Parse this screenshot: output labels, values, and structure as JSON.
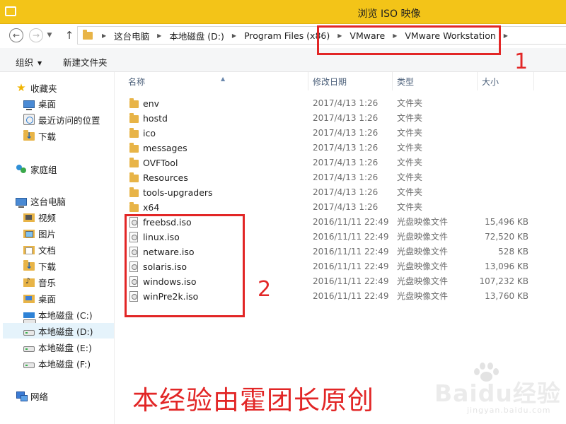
{
  "window": {
    "title": "浏览 ISO 映像",
    "accent_color": "#f3c418"
  },
  "address": {
    "crumbs": [
      "这台电脑",
      "本地磁盘 (D:)",
      "Program Files (x86)",
      "VMware",
      "VMware Workstation"
    ]
  },
  "toolbar": {
    "organize_label": "组织",
    "new_folder_label": "新建文件夹"
  },
  "sidebar": {
    "favorites": {
      "label": "收藏夹",
      "items": [
        "桌面",
        "最近访问的位置",
        "下载"
      ]
    },
    "homegroup": {
      "label": "家庭组"
    },
    "this_pc": {
      "label": "这台电脑",
      "items": [
        "视频",
        "图片",
        "文档",
        "下载",
        "音乐",
        "桌面",
        "本地磁盘 (C:)",
        "本地磁盘 (D:)",
        "本地磁盘 (E:)",
        "本地磁盘 (F:)"
      ],
      "selected": "本地磁盘 (D:)"
    },
    "network": {
      "label": "网络"
    }
  },
  "columns": {
    "name": "名称",
    "modified": "修改日期",
    "type": "类型",
    "size": "大小"
  },
  "files": [
    {
      "name": "env",
      "date": "2017/4/13 1:26",
      "type": "文件夹",
      "size": "",
      "kind": "folder"
    },
    {
      "name": "hostd",
      "date": "2017/4/13 1:26",
      "type": "文件夹",
      "size": "",
      "kind": "folder"
    },
    {
      "name": "ico",
      "date": "2017/4/13 1:26",
      "type": "文件夹",
      "size": "",
      "kind": "folder"
    },
    {
      "name": "messages",
      "date": "2017/4/13 1:26",
      "type": "文件夹",
      "size": "",
      "kind": "folder"
    },
    {
      "name": "OVFTool",
      "date": "2017/4/13 1:26",
      "type": "文件夹",
      "size": "",
      "kind": "folder"
    },
    {
      "name": "Resources",
      "date": "2017/4/13 1:26",
      "type": "文件夹",
      "size": "",
      "kind": "folder"
    },
    {
      "name": "tools-upgraders",
      "date": "2017/4/13 1:26",
      "type": "文件夹",
      "size": "",
      "kind": "folder"
    },
    {
      "name": "x64",
      "date": "2017/4/13 1:26",
      "type": "文件夹",
      "size": "",
      "kind": "folder"
    },
    {
      "name": "freebsd.iso",
      "date": "2016/11/11 22:49",
      "type": "光盘映像文件",
      "size": "15,496 KB",
      "kind": "iso"
    },
    {
      "name": "linux.iso",
      "date": "2016/11/11 22:49",
      "type": "光盘映像文件",
      "size": "72,520 KB",
      "kind": "iso"
    },
    {
      "name": "netware.iso",
      "date": "2016/11/11 22:49",
      "type": "光盘映像文件",
      "size": "528 KB",
      "kind": "iso"
    },
    {
      "name": "solaris.iso",
      "date": "2016/11/11 22:49",
      "type": "光盘映像文件",
      "size": "13,096 KB",
      "kind": "iso"
    },
    {
      "name": "windows.iso",
      "date": "2016/11/11 22:49",
      "type": "光盘映像文件",
      "size": "107,232 KB",
      "kind": "iso"
    },
    {
      "name": "winPre2k.iso",
      "date": "2016/11/11 22:49",
      "type": "光盘映像文件",
      "size": "13,760 KB",
      "kind": "iso"
    }
  ],
  "annotations": {
    "marker_1": "1",
    "marker_2": "2",
    "caption": "本经验由霍团长原创",
    "annotation_color": "#e22626"
  },
  "watermark": {
    "brand": "Baidu经验",
    "url": "jingyan.baidu.com"
  }
}
